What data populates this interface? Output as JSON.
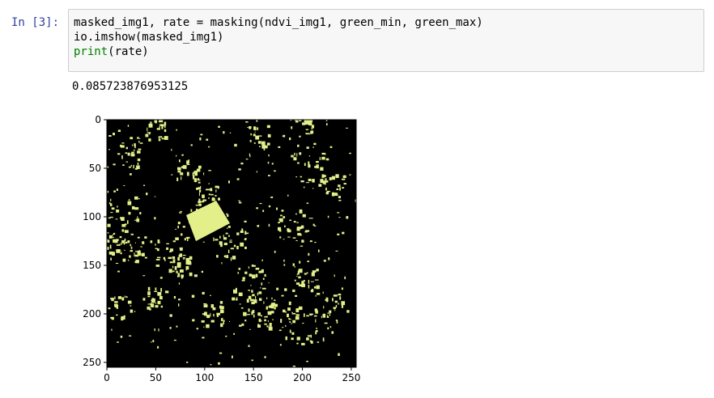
{
  "cell": {
    "prompt": "In [3]:",
    "code": {
      "line1": "masked_img1, rate = masking(ndvi_img1, green_min, green_max)",
      "line2": "io.imshow(masked_img1)",
      "line3_kw": "print",
      "line3_rest": "(rate)"
    }
  },
  "output": {
    "value": "0.085723876953125"
  },
  "chart_data": {
    "type": "heatmap",
    "title": "",
    "xlabel": "",
    "ylabel": "",
    "xlim": [
      0,
      255
    ],
    "ylim": [
      255,
      0
    ],
    "xticks": [
      "0",
      "50",
      "100",
      "150",
      "200",
      "250"
    ],
    "yticks": [
      "0",
      "50",
      "100",
      "150",
      "200",
      "250"
    ],
    "colors": {
      "background": "#000000",
      "mask": "#e3f08a"
    }
  }
}
